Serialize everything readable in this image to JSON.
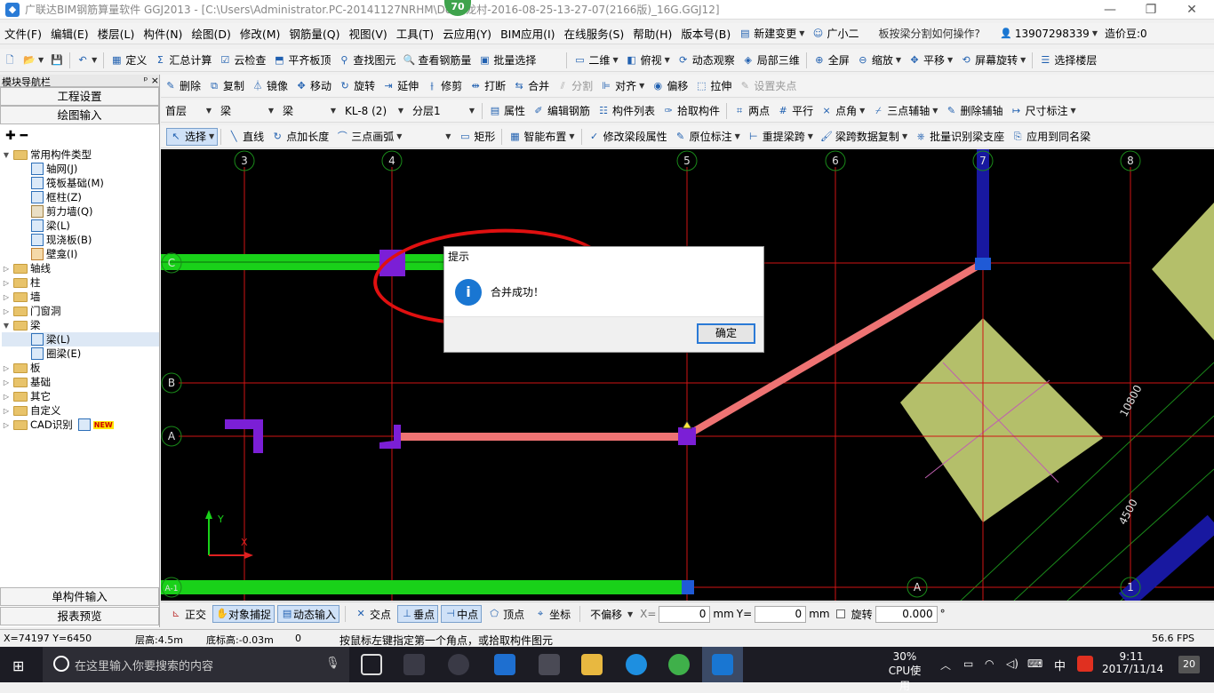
{
  "titlebar": {
    "title": "广联达BIM钢筋算量软件 GGJ2013 - [C:\\Users\\Administrator.PC-20141127NRHM\\De",
    "title_tail": "白龙村-2016-08-25-13-27-07(2166版)_16G.GGJ12]",
    "badge": "70",
    "min": "—",
    "max": "❐",
    "close": "✕"
  },
  "menubar": {
    "items": [
      "文件(F)",
      "编辑(E)",
      "楼层(L)",
      "构件(N)",
      "绘图(D)",
      "修改(M)",
      "钢筋量(Q)",
      "视图(V)",
      "工具(T)",
      "云应用(Y)",
      "BIM应用(I)",
      "在线服务(S)",
      "帮助(H)",
      "版本号(B)"
    ],
    "new_change": "新建变更",
    "assistant": "广小二",
    "question": "板按梁分割如何操作?",
    "phone": "13907298339",
    "price": "造价豆:0"
  },
  "toolbar1": {
    "items": [
      "定义",
      "汇总计算",
      "云检查",
      "平齐板顶",
      "查找图元",
      "查看钢筋量",
      "批量选择"
    ],
    "view2d": "二维",
    "top_view": "俯视",
    "dynamic": "动态观察",
    "local3d": "局部三维",
    "fullscreen": "全屏",
    "zoom": "缩放",
    "pan": "平移",
    "rotate_screen": "屏幕旋转",
    "select_floor": "选择楼层"
  },
  "toolbar2": {
    "items": [
      "删除",
      "复制",
      "镜像",
      "移动",
      "旋转",
      "延伸",
      "修剪",
      "打断",
      "合并",
      "分割",
      "对齐",
      "偏移",
      "拉伸",
      "设置夹点"
    ]
  },
  "toolbar3": {
    "floor": "首层",
    "type": "梁",
    "subtype": "梁",
    "component": "KL-8 (2)",
    "layer": "分层1",
    "items": [
      "属性",
      "编辑钢筋",
      "构件列表",
      "拾取构件",
      "两点",
      "平行",
      "点角",
      "三点辅轴",
      "删除辅轴",
      "尺寸标注"
    ]
  },
  "toolbar4": {
    "select": "选择",
    "items": [
      "直线",
      "点加长度",
      "三点画弧",
      "矩形",
      "智能布置",
      "修改梁段属性",
      "原位标注",
      "重提梁跨",
      "梁跨数据复制",
      "批量识别梁支座",
      "应用到同名梁"
    ]
  },
  "nav": {
    "header": "模块导航栏",
    "pin": "ᵖ",
    "close": "×",
    "project_settings": "工程设置",
    "drawing_input": "绘图输入",
    "single_input": "单构件输入",
    "report_preview": "报表预览",
    "common_types": "常用构件类型",
    "common_items": [
      "轴网(J)",
      "筏板基础(M)",
      "框柱(Z)",
      "剪力墙(Q)",
      "梁(L)",
      "现浇板(B)",
      "壁龛(I)"
    ],
    "groups": [
      "轴线",
      "柱",
      "墙",
      "门窗洞"
    ],
    "beam_group": "梁",
    "beam_items": [
      "梁(L)",
      "圈梁(E)"
    ],
    "groups2": [
      "板",
      "基础",
      "其它",
      "自定义",
      "CAD识别"
    ],
    "new_badge": "NEW"
  },
  "canvas": {
    "axes_top": [
      "3",
      "4",
      "5",
      "6",
      "7",
      "8"
    ],
    "axes_left": [
      "C",
      "B",
      "A",
      "A-1"
    ],
    "axis_bottom": [
      "A",
      "1"
    ],
    "dim1": "10800",
    "dim2": "4500",
    "ucs_y": "Y",
    "ucs_x": "X",
    "colors": {
      "grid": "#d11414",
      "beam_green": "#19d119",
      "beam_pink": "#ee7373",
      "column": "#7b1fd6",
      "blue": "#1818a0",
      "slab": "#b4bf6a"
    }
  },
  "dialog": {
    "title": "提示",
    "icon": "i",
    "message": "合并成功！",
    "ok": "确定"
  },
  "snapbar": {
    "ortho": "正交",
    "snap": "对象捕捉",
    "dynamic_input": "动态输入",
    "intersection": "交点",
    "perp": "垂点",
    "midpoint": "中点",
    "vertex": "顶点",
    "coord": "坐标",
    "offset": "不偏移",
    "x_label": "X=",
    "x_value": "0",
    "x_unit": "mm",
    "y_label": "Y=",
    "y_value": "0",
    "y_unit": "mm",
    "rotate_label": "旋转",
    "rotate_value": "0.000",
    "deg": "°"
  },
  "status": {
    "coords": "X=74197 Y=6450",
    "floor_height": "层高:4.5m",
    "bottom_elev": "底标高:-0.03m",
    "zero": "0",
    "hint": "按鼠标左键指定第一个角点，或拾取构件图元",
    "fps": "56.6 FPS"
  },
  "taskbar": {
    "search": "在这里输入你要搜索的内容",
    "cpu_pct": "30%",
    "cpu_label": "CPU使用",
    "ime": "中",
    "time": "9:11",
    "date": "2017/11/14",
    "notif": "20"
  }
}
